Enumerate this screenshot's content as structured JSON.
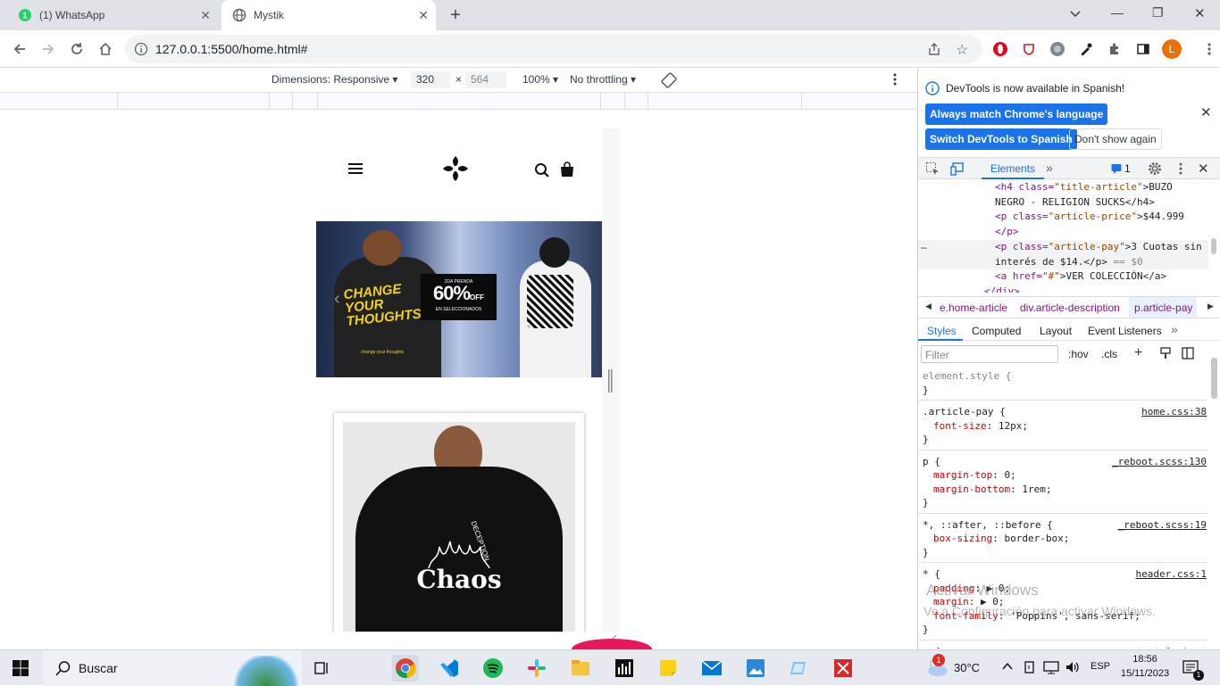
{
  "browser": {
    "tabs": [
      {
        "title": "(1) WhatsApp",
        "badge": "1"
      },
      {
        "title": "Mystik"
      }
    ],
    "new_tab": "+",
    "window_controls": {
      "minimize": "—",
      "maximize": "❐",
      "close": "✕"
    },
    "url": "127.0.0.1:5500/home.html#",
    "profile_initial": "L"
  },
  "device_toolbar": {
    "dimensions_label": "Dimensions: Responsive",
    "width": "320",
    "times": "×",
    "height": "564",
    "zoom": "100%",
    "throttling": "No throttling"
  },
  "site": {
    "banner": {
      "promo_small": "2DA PRENDA",
      "promo_big": "60%",
      "promo_off": "OFF",
      "promo_sub": "EN SELECCIONADOS",
      "hoodie_text": "CHANGE YOUR THOUGHTS",
      "hoodie_small": "change your thoughts"
    },
    "product": {
      "graphic_text": "Chaos",
      "side_text": "DECEPTION"
    }
  },
  "devtools": {
    "infobar_text": "DevTools is now available in Spanish!",
    "btn_match": "Always match Chrome's language",
    "btn_switch": "Switch DevTools to Spanish",
    "btn_dont_show": "Don't show again",
    "main_tab": "Elements",
    "issues_count": "1",
    "dom_lines": [
      {
        "pre": "<h4 class=",
        "attr": "\"title-article\"",
        "post": ">BUZO"
      },
      {
        "pre": "NEGRO - RELIGION SUCKS</h4>",
        "attr": "",
        "post": ""
      },
      {
        "pre": "<p class=",
        "attr": "\"article-price\"",
        "post": ">$44.999"
      },
      {
        "pre": "</p>",
        "attr": "",
        "post": ""
      },
      {
        "pre": "<p class=",
        "attr": "\"article-pay\"",
        "post": ">3 Cuotas sin"
      },
      {
        "pre": "interés de $14.</p>",
        "attr": "",
        "post": " == $0"
      },
      {
        "pre": "<a href=",
        "attr": "\"#\"",
        "post": ">VER COLECCIÓN</a>"
      },
      {
        "pre": "</div>",
        "attr": "",
        "post": ""
      }
    ],
    "breadcrumbs": [
      "e.home-article",
      "div.article-description",
      "p.article-pay"
    ],
    "sub_tabs": [
      "Styles",
      "Computed",
      "Layout",
      "Event Listeners"
    ],
    "filter_placeholder": "Filter",
    "hov": ":hov",
    "cls": ".cls",
    "rules": [
      {
        "selector": "element.style {",
        "source": "",
        "props": [],
        "close": "}"
      },
      {
        "selector": ".article-pay {",
        "source": "home.css:38",
        "props": [
          {
            "name": "font-size",
            "value": "12px;"
          }
        ],
        "close": "}"
      },
      {
        "selector": "p {",
        "source": "_reboot.scss:130",
        "props": [
          {
            "name": "margin-top",
            "value": "0;"
          },
          {
            "name": "margin-bottom",
            "value": "1rem;"
          }
        ],
        "close": "}"
      },
      {
        "selector": "*, ::after, ::before {",
        "source": "_reboot.scss:19",
        "props": [
          {
            "name": "box-sizing",
            "value": "border-box;"
          }
        ],
        "close": "}"
      },
      {
        "selector": "* {",
        "source": "header.css:1",
        "props": [
          {
            "name": "padding",
            "value": "▶ 0;"
          },
          {
            "name": "margin",
            "value": "▶ 0;"
          },
          {
            "name": "font-family",
            "value": "'Poppins', sans-serif;"
          }
        ],
        "close": "}"
      },
      {
        "selector": "p {",
        "source": "user agent stylesheet",
        "props": [
          {
            "name": "display",
            "value": "block;"
          }
        ],
        "close": ""
      }
    ],
    "watermark_line1": "Activar Windows",
    "watermark_line2": "Ve a Configuración para activar Windows."
  },
  "taskbar": {
    "search_label": "Buscar",
    "weather": "30°C",
    "weather_badge": "1",
    "lang": "ESP",
    "time": "18:56",
    "date": "15/11/2023",
    "notifications": "1"
  }
}
